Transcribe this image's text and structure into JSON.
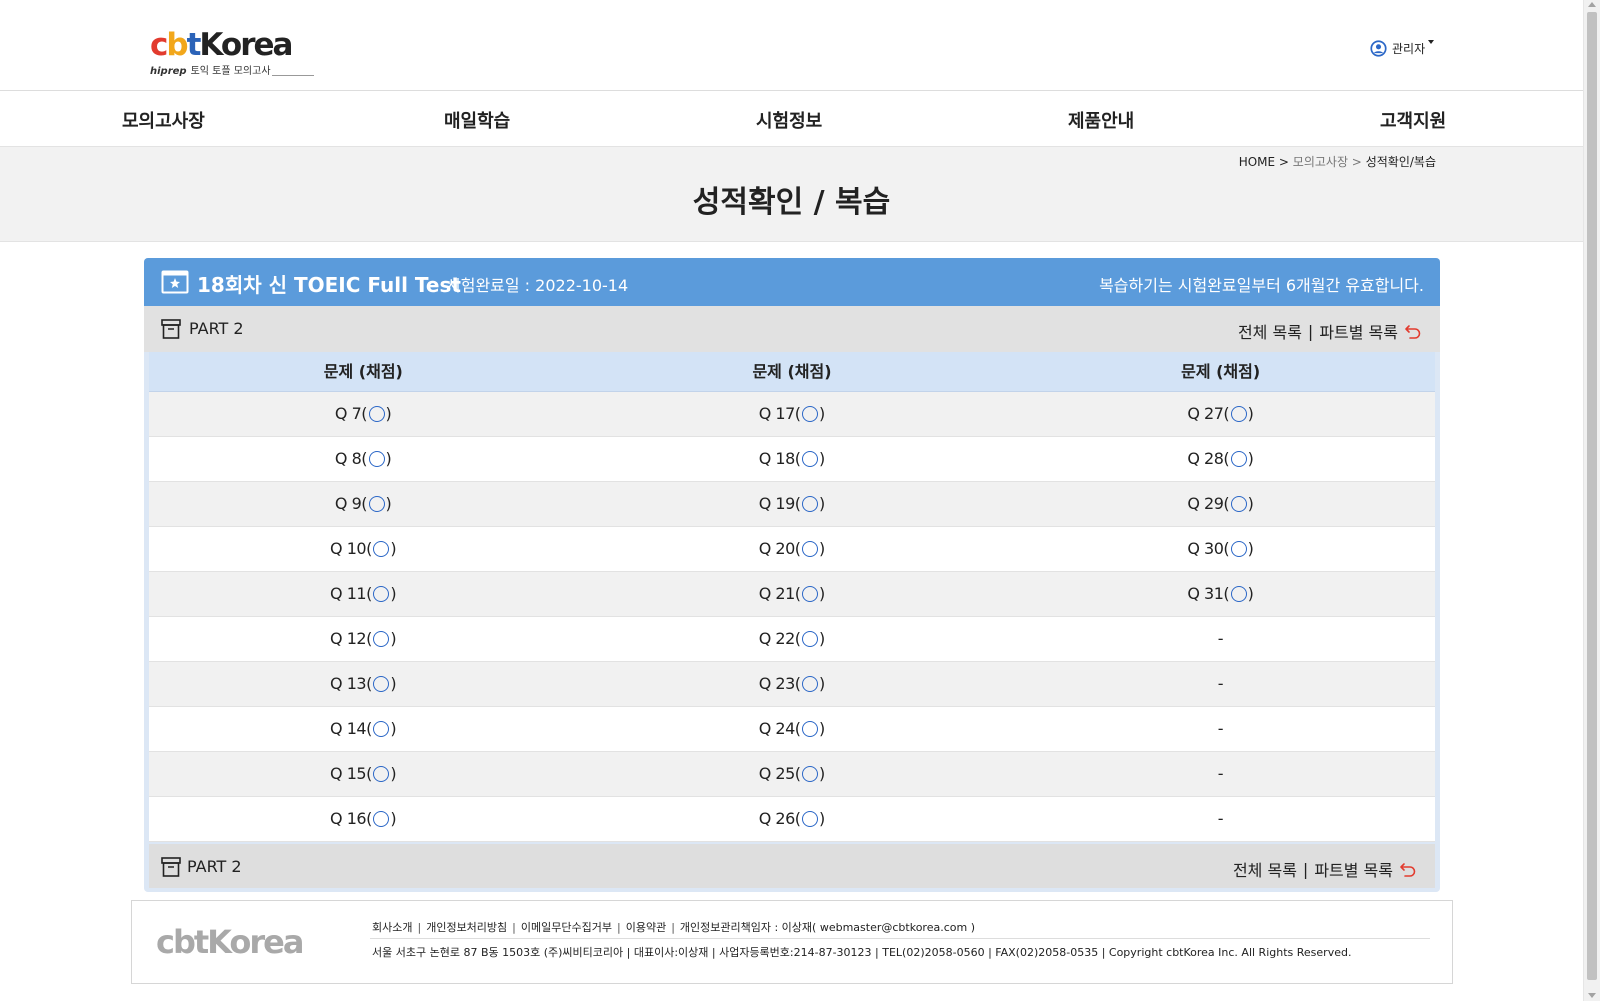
{
  "header": {
    "logo": {
      "brand_parts": [
        "c",
        "b",
        "t",
        "Korea"
      ],
      "hiprep": "hiprep",
      "tagline": "토익 토플 모의고사"
    },
    "user_label": "관리자"
  },
  "nav": {
    "items": [
      "모의고사장",
      "매일학습",
      "시험정보",
      "제품안내",
      "고객지원"
    ]
  },
  "breadcrumb": {
    "home": "HOME >",
    "mid": "모의고사장 >",
    "current": "성적확인/복습"
  },
  "page_title": "성적확인 / 복습",
  "card": {
    "test_title": "18회차 신 TOEIC Full Test",
    "complete_date": "시험완료일 : 2022-10-14",
    "notice": "복습하기는 시험완료일부터 6개월간 유효합니다.",
    "part_label": "PART 2",
    "link_all": "전체 목록",
    "link_sep": "|",
    "link_part": "파트별 목록"
  },
  "table": {
    "headers": [
      "문제 (채점)",
      "문제 (채점)",
      "문제 (채점)"
    ],
    "rows": [
      [
        "Q 7",
        "Q 17",
        "Q 27"
      ],
      [
        "Q 8",
        "Q 18",
        "Q 28"
      ],
      [
        "Q 9",
        "Q 19",
        "Q 29"
      ],
      [
        "Q 10",
        "Q 20",
        "Q 30"
      ],
      [
        "Q 11",
        "Q 21",
        "Q 31"
      ],
      [
        "Q 12",
        "Q 22",
        "-"
      ],
      [
        "Q 13",
        "Q 23",
        "-"
      ],
      [
        "Q 14",
        "Q 24",
        "-"
      ],
      [
        "Q 15",
        "Q 25",
        "-"
      ],
      [
        "Q 16",
        "Q 26",
        "-"
      ]
    ]
  },
  "footer": {
    "logo": "cbtKorea",
    "links": [
      "회사소개",
      "개인정보처리방침",
      "이메일무단수집거부",
      "이용약관",
      "개인정보관리책임자 : 이상재( webmaster@cbtkorea.com )"
    ],
    "info": "서울 서초구 논현로 87 B동 1503호 (주)씨비티코리아 | 대표이사:이상재 | 사업자등록번호:214-87-30123 | TEL(02)2058-0560 | FAX(02)2058-0535 | Copyright cbtKorea Inc. All Rights Reserved."
  },
  "colors": {
    "header_blue": "#5b9bdb",
    "table_header": "#d3e3f6",
    "answer_circle": "#2b67c7",
    "back_arrow": "#e23b2e"
  }
}
